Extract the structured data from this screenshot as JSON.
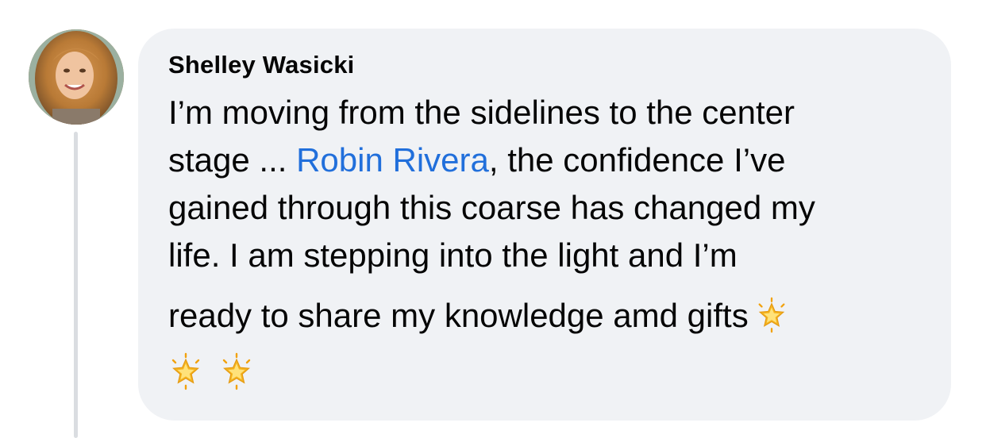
{
  "comment": {
    "author": "Shelley Wasicki",
    "avatar_icon": "profile-photo",
    "line1": "I’m moving from the sidelines to the center",
    "line2_before": "stage ... ",
    "mention": "Robin Rivera",
    "line2_after": ", the confidence I’ve",
    "line3": "gained through this coarse has changed my",
    "line4": "life.  I am stepping into the light and I’m",
    "line5": "ready to share my knowledge amd gifts",
    "emoji": "glowing-star",
    "emoji_count_total": 3
  },
  "colors": {
    "bubble_background": "#f0f2f5",
    "mention_link": "#216fdb",
    "text": "#050505",
    "thread_line": "#dadde1"
  }
}
